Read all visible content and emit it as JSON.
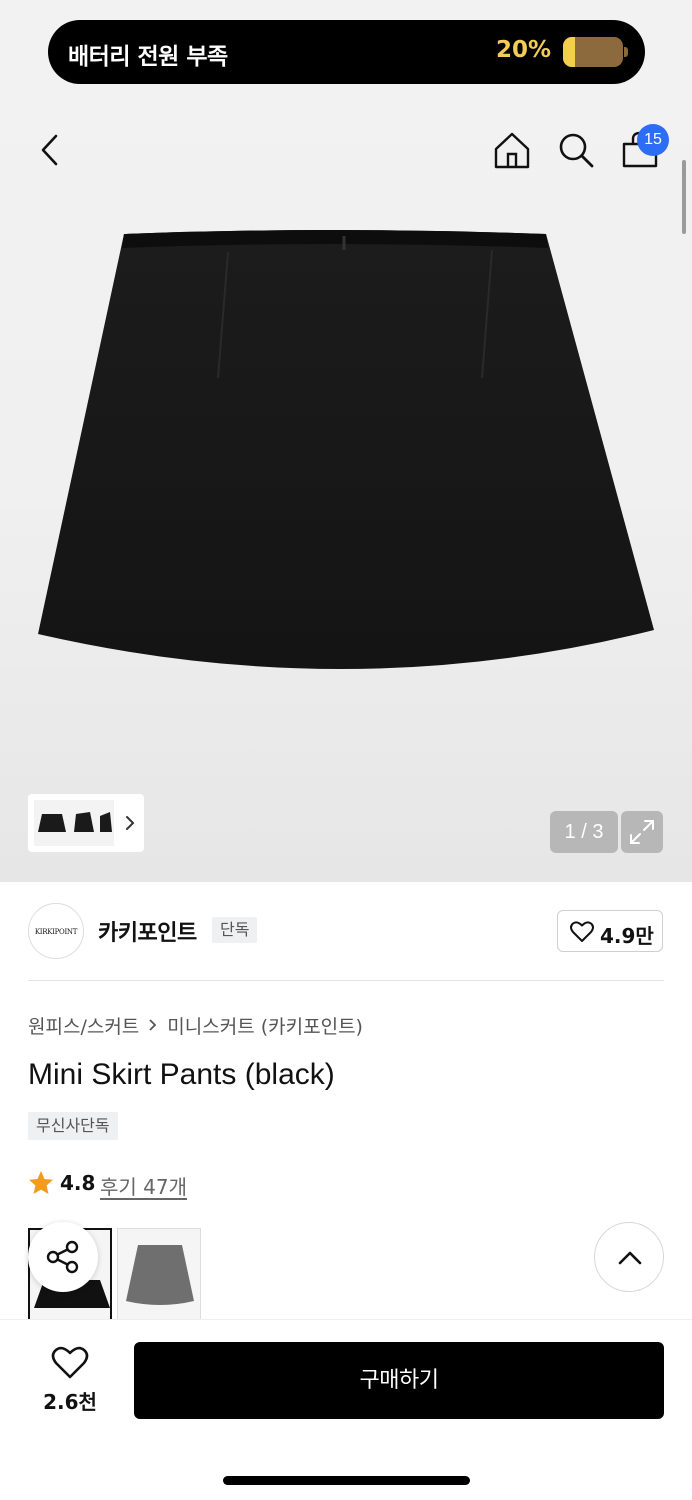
{
  "status_banner": {
    "message": "배터리 전원 부족",
    "percent_label": "20%",
    "battery_level": 0.2,
    "accent_color": "#f3cc55"
  },
  "topbar": {
    "back_icon": "chevron-left-icon",
    "home_icon": "home-icon",
    "search_icon": "search-icon",
    "cart_icon": "bag-icon",
    "cart_badge": "15",
    "badge_color": "#2d6df6"
  },
  "gallery": {
    "pager": "1 / 3",
    "expand_icon": "expand-icon",
    "thumb_more_icon": "chevron-right-icon"
  },
  "brand": {
    "logo_text": "KIRKIPOINT",
    "name": "카키포인트",
    "tag": "단독",
    "likes": "4.9만"
  },
  "product": {
    "breadcrumb": [
      "원피스/스커트",
      "미니스커트 (카키포인트)"
    ],
    "title": "Mini Skirt Pants (black)",
    "badge": "무신사단독",
    "rating": "4.8",
    "reviews": "후기 47개"
  },
  "floating": {
    "share_icon": "share-icon",
    "top_icon": "chevron-up-icon"
  },
  "purchase_bar": {
    "wish_count": "2.6천",
    "buy_label": "구매하기"
  }
}
